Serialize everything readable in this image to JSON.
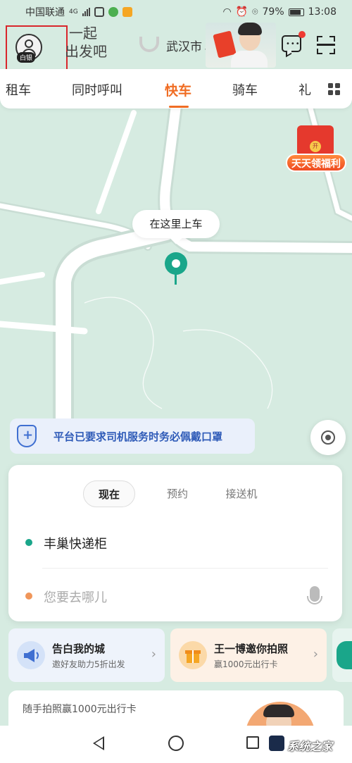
{
  "status_bar": {
    "carrier": "中国联通",
    "network": "4G",
    "battery": "79%",
    "time": "13:08"
  },
  "header": {
    "vip_badge": "白银",
    "slogan_line1": "一起",
    "slogan_line2": "出发吧",
    "city": "武汉市"
  },
  "tabs": [
    {
      "label": "租车",
      "active": false
    },
    {
      "label": "同时呼叫",
      "active": false
    },
    {
      "label": "快车",
      "active": true
    },
    {
      "label": "骑车",
      "active": false
    },
    {
      "label": "礼",
      "active": false
    }
  ],
  "promo": {
    "label": "天天领福利",
    "coin": "开"
  },
  "map": {
    "pickup_tip": "在这里上车"
  },
  "notice": {
    "text": "平台已要求司机服务时务必佩戴口罩"
  },
  "booking": {
    "modes": [
      {
        "label": "现在",
        "active": true
      },
      {
        "label": "预约",
        "active": false
      },
      {
        "label": "接送机",
        "active": false
      }
    ],
    "origin": "丰巢快递柜",
    "destination_placeholder": "您要去哪儿"
  },
  "cards": [
    {
      "title": "告白我的城",
      "subtitle": "邀好友助力5折出发"
    },
    {
      "title": "王一博邀你拍照",
      "subtitle": "赢1000元出行卡"
    }
  ],
  "bottom_card": {
    "text": "随手拍照赢1000元出行卡"
  },
  "watermark": {
    "text": "系统之家"
  },
  "colors": {
    "accent": "#f06d24",
    "pin": "#1aa68a",
    "notice_text": "#2f5bb8",
    "map_bg": "#d6ebe1"
  }
}
